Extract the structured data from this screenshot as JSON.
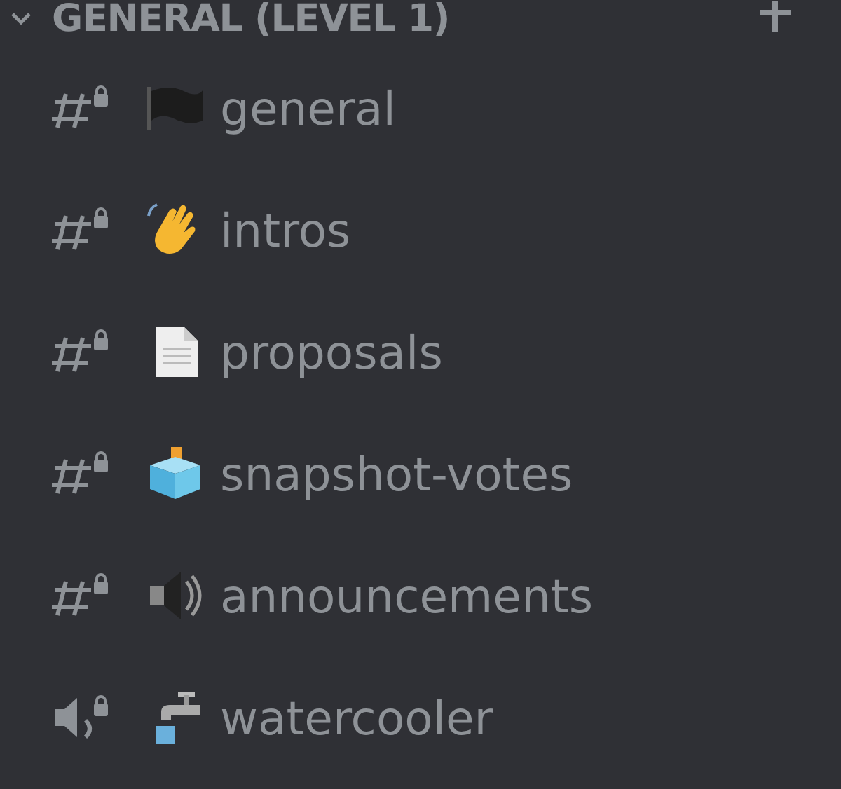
{
  "category": {
    "title": "GENERAL (LEVEL 1)",
    "expanded": true
  },
  "channels": [
    {
      "kind": "text",
      "name": "general",
      "locked": true
    },
    {
      "kind": "text",
      "name": "intros",
      "locked": true
    },
    {
      "kind": "text",
      "name": "proposals",
      "locked": true
    },
    {
      "kind": "text",
      "name": "snapshot-votes",
      "locked": true
    },
    {
      "kind": "text",
      "name": "announcements",
      "locked": true
    },
    {
      "kind": "voice",
      "name": "watercooler",
      "locked": true
    }
  ]
}
